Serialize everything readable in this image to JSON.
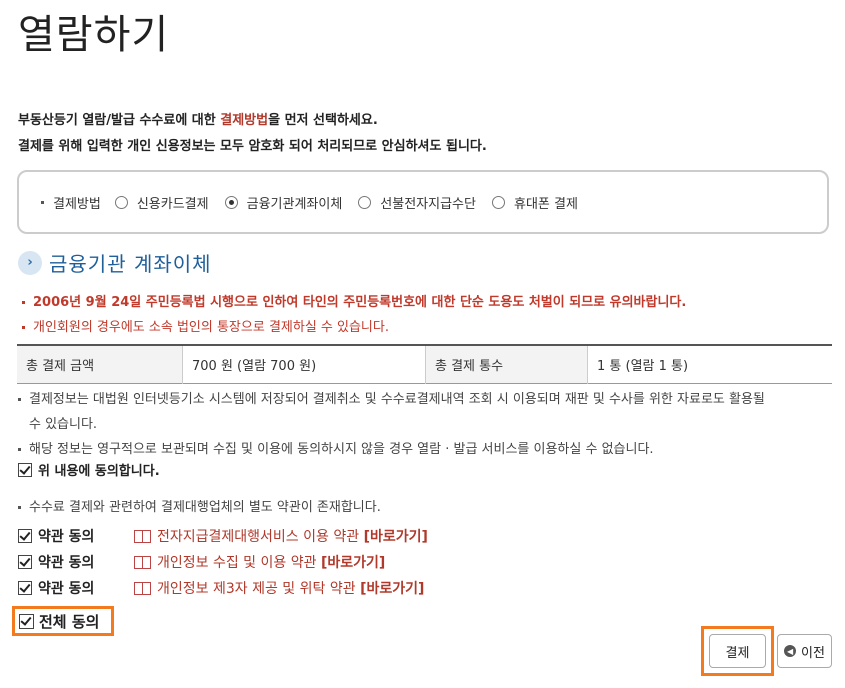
{
  "page": {
    "title": "열람하기"
  },
  "intro": {
    "line1_pre": "부동산등기 열람/발급 수수료에 대한 ",
    "line1_highlight": "결제방법",
    "line1_post": "을 먼저 선택하세요.",
    "line2": "결제를 위해 입력한 개인 신용정보는 모두 암호화 되어 처리되므로 안심하셔도 됩니다."
  },
  "payment_method": {
    "label": "결제방법",
    "options": [
      {
        "label": "신용카드결제",
        "selected": false
      },
      {
        "label": "금융기관계좌이체",
        "selected": true
      },
      {
        "label": "선불전자지급수단",
        "selected": false
      },
      {
        "label": "휴대폰 결제",
        "selected": false
      }
    ]
  },
  "section": {
    "title": "금융기관 계좌이체"
  },
  "warnings": {
    "w1": "2006년 9월 24일 주민등록법 시행으로 인하여 타인의 주민등록번호에 대한 단순 도용도 처벌이 되므로 유의바랍니다.",
    "w2": "개인회원의 경우에도 소속 법인의 통장으로 결제하실 수 있습니다."
  },
  "summary": {
    "total_amount_label": "총 결제 금액",
    "total_amount_value": "700 원 (열람 700 원)",
    "total_count_label": "총 결제 통수",
    "total_count_value": "1 통 (열람 1 통)"
  },
  "notes": {
    "n1a": "결제정보는 대법원 인터넷등기소 시스템에 저장되어 결제취소 및 수수료결제내역 조회 시 이용되며 재판 및 수사를 위한 자료로도 활용될",
    "n1b": "수 있습니다.",
    "n2": "해당 정보는 영구적으로 보관되며 수집 및 이용에 동의하시지 않을 경우 열람 · 발급 서비스를 이용하실 수 없습니다.",
    "agree_label": "위 내용에 동의합니다.",
    "n3": "수수료 결제와 관련하여 결제대행업체의 별도 약관이 존재합니다."
  },
  "terms": [
    {
      "label": "약관 동의",
      "link_text": "전자지급결제대행서비스 이용 약관",
      "go": "[바로가기]"
    },
    {
      "label": "약관 동의",
      "link_text": "개인정보 수집 및 이용 약관",
      "go": "[바로가기]"
    },
    {
      "label": "약관 동의",
      "link_text": "개인정보 제3자 제공 및 위탁 약관",
      "go": "[바로가기]"
    }
  ],
  "all_agree": {
    "label": "전체 동의"
  },
  "buttons": {
    "pay": "결제",
    "prev": "이전"
  },
  "colors": {
    "highlight": "#f47a20",
    "warning": "#c0392b",
    "section": "#1f5f9a"
  }
}
